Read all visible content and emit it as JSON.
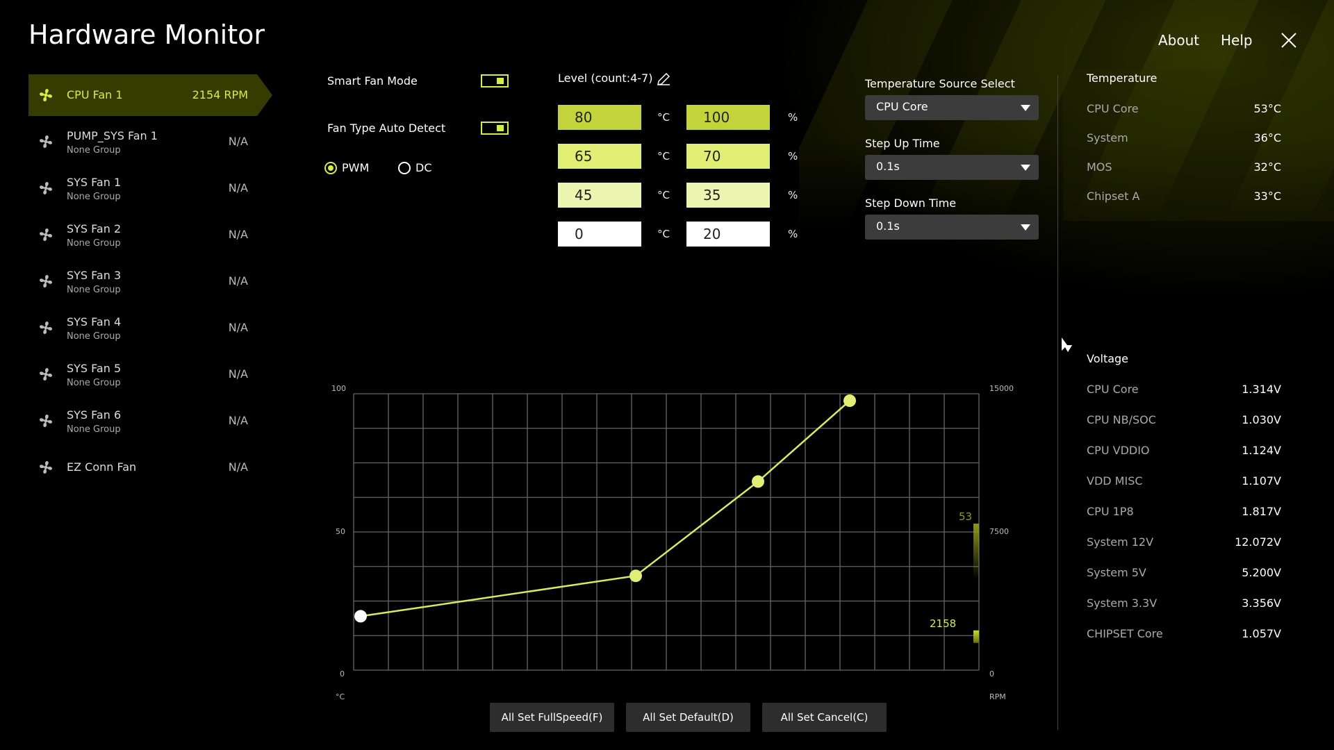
{
  "app": {
    "title": "Hardware Monitor",
    "about": "About",
    "help": "Help"
  },
  "fans": [
    {
      "name": "CPU Fan 1",
      "group": "",
      "value": "2154 RPM",
      "selected": true
    },
    {
      "name": "PUMP_SYS Fan 1",
      "group": "None Group",
      "value": "N/A"
    },
    {
      "name": "SYS Fan 1",
      "group": "None Group",
      "value": "N/A"
    },
    {
      "name": "SYS Fan 2",
      "group": "None Group",
      "value": "N/A"
    },
    {
      "name": "SYS Fan 3",
      "group": "None Group",
      "value": "N/A"
    },
    {
      "name": "SYS Fan 4",
      "group": "None Group",
      "value": "N/A"
    },
    {
      "name": "SYS Fan 5",
      "group": "None Group",
      "value": "N/A"
    },
    {
      "name": "SYS Fan 6",
      "group": "None Group",
      "value": "N/A"
    },
    {
      "name": "EZ Conn Fan",
      "group": "",
      "value": "N/A"
    }
  ],
  "controls": {
    "smart_fan_mode": "Smart Fan Mode",
    "smart_fan_on": true,
    "fan_type_auto": "Fan Type Auto Detect",
    "fan_type_on": true,
    "pwm": "PWM",
    "dc": "DC",
    "selected_type": "PWM"
  },
  "levels": {
    "label": "Level (count:4-7)",
    "temp_unit": "°C",
    "pct_unit": "%",
    "rows": [
      {
        "temp": "80",
        "pct": "100",
        "color": "#c2d43a"
      },
      {
        "temp": "65",
        "pct": "70",
        "color": "#e0ef73"
      },
      {
        "temp": "45",
        "pct": "35",
        "color": "#ecf5b0"
      },
      {
        "temp": "0",
        "pct": "20",
        "color": "#ffffff"
      }
    ]
  },
  "settings": {
    "temp_source_label": "Temperature Source Select",
    "temp_source": "CPU Core",
    "step_up_label": "Step Up Time",
    "step_up": "0.1s",
    "step_down_label": "Step Down Time",
    "step_down": "0.1s"
  },
  "temperature": {
    "title": "Temperature",
    "rows": [
      {
        "label": "CPU Core",
        "value": "53°C"
      },
      {
        "label": "System",
        "value": "36°C"
      },
      {
        "label": "MOS",
        "value": "32°C"
      },
      {
        "label": "Chipset A",
        "value": "33°C"
      }
    ]
  },
  "voltage": {
    "title": "Voltage",
    "rows": [
      {
        "label": "CPU Core",
        "value": "1.314V"
      },
      {
        "label": "CPU NB/SOC",
        "value": "1.030V"
      },
      {
        "label": "CPU VDDIO",
        "value": "1.124V"
      },
      {
        "label": "VDD MISC",
        "value": "1.107V"
      },
      {
        "label": "CPU 1P8",
        "value": "1.817V"
      },
      {
        "label": "System 12V",
        "value": "12.072V"
      },
      {
        "label": "System 5V",
        "value": "5.200V"
      },
      {
        "label": "System 3.3V",
        "value": "3.356V"
      },
      {
        "label": "CHIPSET Core",
        "value": "1.057V"
      }
    ]
  },
  "chart_data": {
    "type": "line",
    "x": [
      0,
      45,
      65,
      80
    ],
    "y": [
      20,
      35,
      70,
      100
    ],
    "xlim": [
      0,
      100
    ],
    "ylim": [
      0,
      100
    ],
    "y_ticks": [
      "100",
      "50",
      "0"
    ],
    "y2_ticks": [
      "15000",
      "7500",
      "0"
    ],
    "y2lim": [
      0,
      15000
    ],
    "xlabel": "°C",
    "y2label": "RPM",
    "grid": true,
    "current_temp": "53",
    "current_rpm": "2158",
    "accent": "#d4f03a"
  },
  "buttons": {
    "fullspeed": "All Set FullSpeed(F)",
    "default": "All Set Default(D)",
    "cancel": "All Set Cancel(C)"
  }
}
